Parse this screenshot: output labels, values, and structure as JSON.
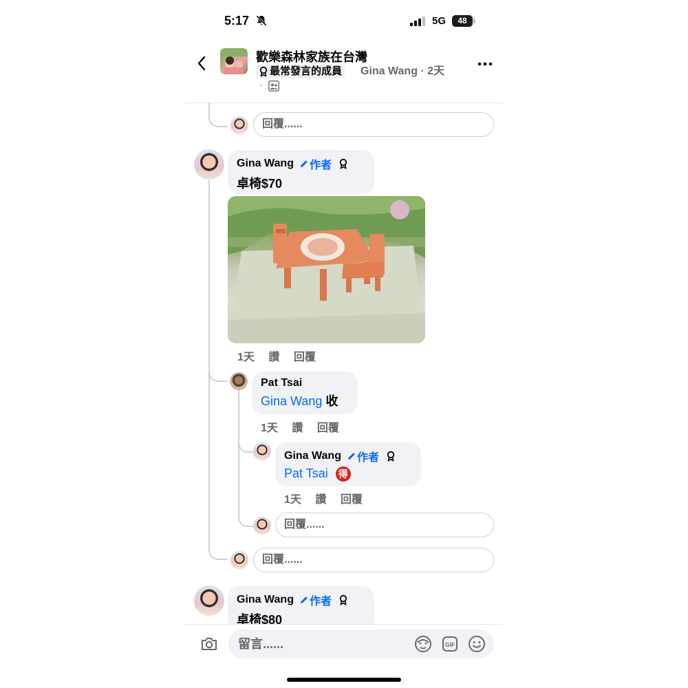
{
  "status_bar": {
    "time": "5:17",
    "network": "5G",
    "battery": "48"
  },
  "header": {
    "group_name": "歡樂森林家族在台灣",
    "badge": "最常發言的成員",
    "author_meta": "Gina Wang · 2天",
    "dot": "·"
  },
  "thread": {
    "reply_placeholder_1": "回覆......",
    "comment_1": {
      "name": "Gina Wang",
      "author_tag": "作者",
      "text": "卓椅$70",
      "time": "1天",
      "like": "讚",
      "reply": "回覆"
    },
    "reply_pat": {
      "name": "Pat Tsai",
      "mention": "Gina Wang",
      "text": " 收",
      "time": "1天",
      "like": "讚",
      "reply": "回覆"
    },
    "reply_gina": {
      "name": "Gina Wang",
      "author_tag": "作者",
      "mention": "Pat Tsai",
      "sticker": "得",
      "time": "1天",
      "like": "讚",
      "reply": "回覆"
    },
    "reply_placeholder_2": "回覆......",
    "reply_placeholder_3": "回覆......",
    "comment_2": {
      "name": "Gina Wang",
      "author_tag": "作者",
      "text": "卓椅$80"
    }
  },
  "composer": {
    "placeholder": "留言......"
  }
}
